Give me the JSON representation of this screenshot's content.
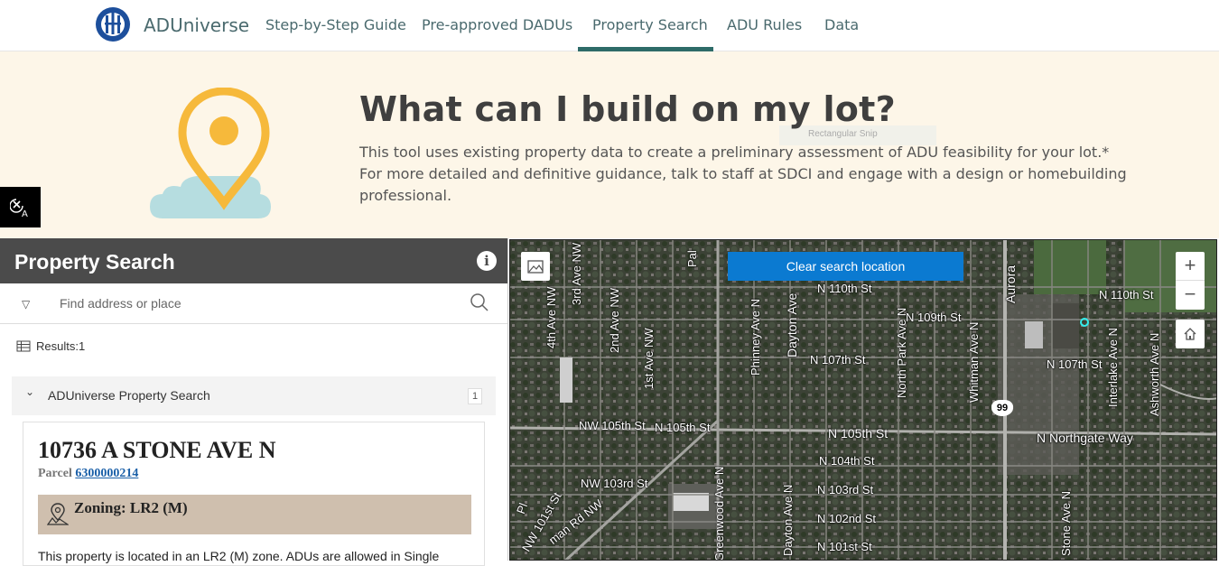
{
  "nav": {
    "brand": "ADUniverse",
    "items": [
      "Step-by-Step Guide",
      "Pre-approved DADUs",
      "Property Search",
      "ADU Rules",
      "Data"
    ],
    "active": "Property Search"
  },
  "hero": {
    "title": "What can I build on my lot?",
    "description": "This tool uses existing property data to create a preliminary assessment of ADU feasibility for your lot.* For more detailed and definitive guidance, talk to staff at SDCI and engage with a design or homebuilding professional.",
    "snip_ghost": "Rectangular Snip"
  },
  "panel": {
    "title": "Property Search",
    "search_placeholder": "Find address or place",
    "results_label": "Results:1",
    "group_title": "ADUniverse Property Search",
    "group_count": "1",
    "card": {
      "address": "10736 A STONE AVE N",
      "parcel_label": "Parcel",
      "parcel_number": "6300000214",
      "zoning": "Zoning: LR2 (M)",
      "body": "This property is located in an LR2 (M) zone. ADUs are allowed in Single"
    }
  },
  "map": {
    "clear_button": "Clear search location",
    "route_shield": "99",
    "labels": {
      "ave3nw": "3rd Ave NW",
      "ave4nw": "4th Ave NW",
      "ave2nw": "2nd Ave NW",
      "ave1nw": "1st Ave NW",
      "phinney": "Phinney Ave N",
      "dayton": "Dayton Ave",
      "n110a": "N 110th St",
      "n110b": "N 110th St",
      "n109": "N 109th St",
      "n107a": "N 107th St",
      "n107b": "N 107th St",
      "nw105": "NW 105th St",
      "n105a": "N 105th St",
      "n105": "N 105th St",
      "northgate": "N Northgate Way",
      "n104": "N 104th St",
      "nw103": "NW 103rd St",
      "n103": "N 103rd St",
      "n102": "N 102nd St",
      "n101": "N 101st St",
      "northpark": "North Park Ave N",
      "whitman": "Whitman Ave N",
      "interlake": "Interlake Ave N",
      "ashworth": "Ashworth Ave N",
      "aurora": "Aurora",
      "greenwood": "Greenwood Ave N",
      "dayton2": "Dayton Ave N",
      "stone": "Stone Ave N",
      "holman": "man Rd NW",
      "nw101": "NW 101st St",
      "pl": "Pl",
      "pal": "Pal"
    }
  }
}
